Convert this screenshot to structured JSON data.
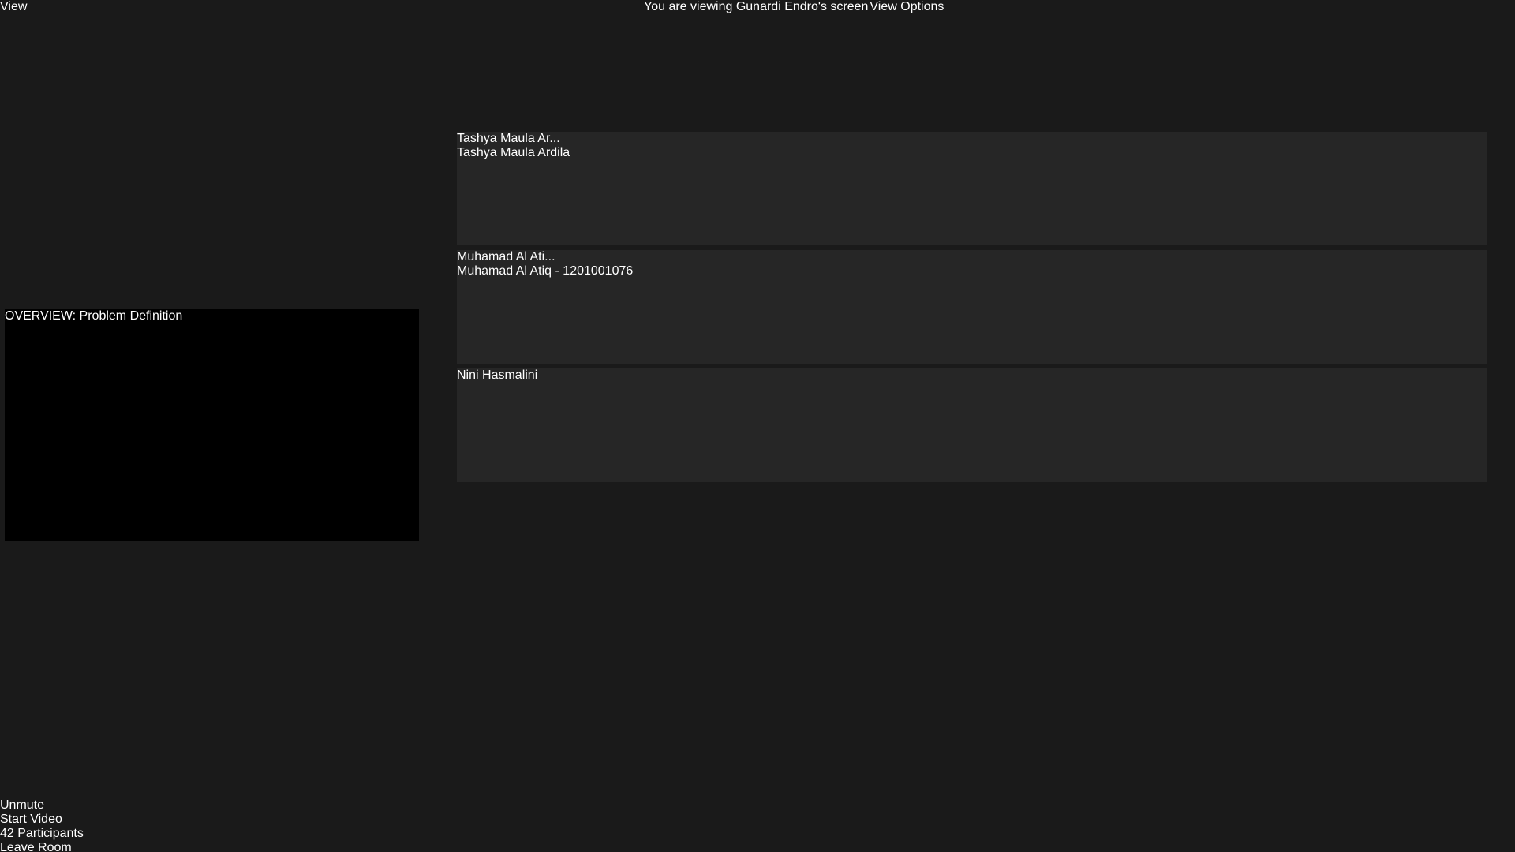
{
  "banner": {
    "viewing_text": "You are viewing Gunardi Endro's screen",
    "view_options_label": "View Options"
  },
  "view_label": "View",
  "shared_slide": {
    "title": "OVERVIEW: Problem Definition"
  },
  "participants": [
    {
      "display": "Tashya  Maula  Ar...",
      "name": "Tashya Maula Ardila"
    },
    {
      "display": "Muhamad  Al  Ati...",
      "name": "Muhamad Al Atiq - 1201001076"
    },
    {
      "display": "",
      "name": "Nini Hasmalini"
    }
  ],
  "toolbar": {
    "unmute": "Unmute",
    "start_video": "Start Video",
    "participants_label": "Participants",
    "participants_count": "42",
    "leave_room": "Leave Room"
  }
}
